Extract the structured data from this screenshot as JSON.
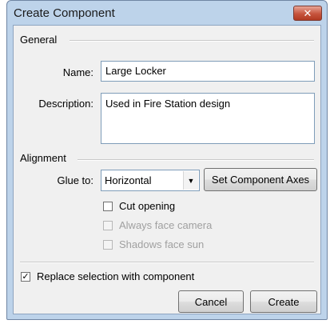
{
  "window": {
    "title": "Create Component",
    "close_label": "✕"
  },
  "general": {
    "heading": "General",
    "name_label": "Name:",
    "name_value": "Large Locker",
    "description_label": "Description:",
    "description_value": "Used in Fire Station design"
  },
  "alignment": {
    "heading": "Alignment",
    "glue_label": "Glue to:",
    "glue_value": "Horizontal",
    "set_axes_label": "Set Component Axes",
    "cut_opening_label": "Cut opening",
    "cut_opening_checked": false,
    "always_face_camera_label": "Always face camera",
    "always_face_camera_checked": false,
    "shadows_face_sun_label": "Shadows face sun",
    "shadows_face_sun_checked": false
  },
  "replace_selection": {
    "label": "Replace selection with component",
    "checked": true,
    "mark": "✓"
  },
  "buttons": {
    "cancel": "Cancel",
    "create": "Create"
  },
  "colors": {
    "frame": "#bdd3ea",
    "client": "#f0f0f0",
    "close_button": "#c6543d"
  }
}
